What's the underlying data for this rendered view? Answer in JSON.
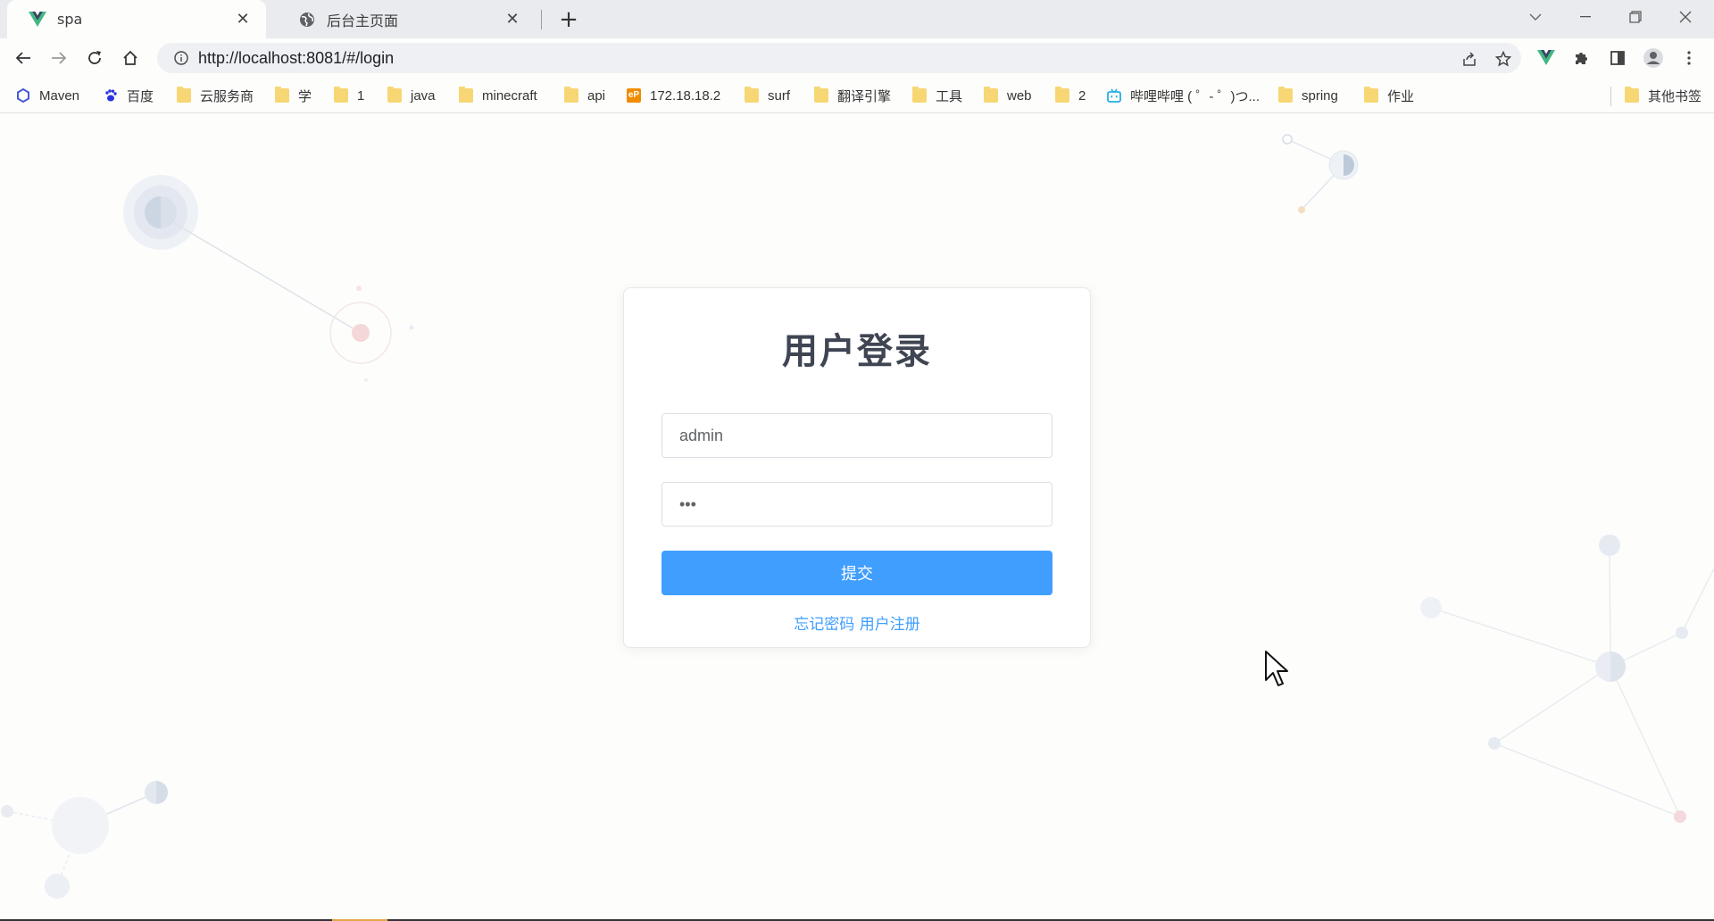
{
  "tabs": [
    {
      "title": "spa",
      "favicon": "vue-logo-icon",
      "active": true
    },
    {
      "title": "后台主页面",
      "favicon": "globe-icon",
      "active": false
    }
  ],
  "address_bar": {
    "url": "http://localhost:8081/#/login"
  },
  "bookmarks": [
    {
      "label": "Maven",
      "icon": "maven-icon"
    },
    {
      "label": "百度",
      "icon": "baidu-paw-icon"
    },
    {
      "label": "云服务商",
      "icon": "folder-icon"
    },
    {
      "label": "学",
      "icon": "folder-icon"
    },
    {
      "label": "1",
      "icon": "folder-icon"
    },
    {
      "label": "java",
      "icon": "folder-icon"
    },
    {
      "label": "minecraft",
      "icon": "folder-icon"
    },
    {
      "label": "api",
      "icon": "folder-icon"
    },
    {
      "label": "172.18.18.2",
      "icon": "ep-icon",
      "badge": "eP"
    },
    {
      "label": "surf",
      "icon": "folder-icon"
    },
    {
      "label": "翻译引擎",
      "icon": "folder-icon"
    },
    {
      "label": "工具",
      "icon": "folder-icon"
    },
    {
      "label": "web",
      "icon": "folder-icon"
    },
    {
      "label": "2",
      "icon": "folder-icon"
    },
    {
      "label": "哔哩哔哩 ( ゜- ゜)つ...",
      "icon": "bilibili-icon"
    },
    {
      "label": "spring",
      "icon": "folder-icon"
    },
    {
      "label": "作业",
      "icon": "folder-icon"
    }
  ],
  "other_bookmarks": {
    "label": "其他书签",
    "icon": "folder-icon"
  },
  "login": {
    "title": "用户登录",
    "username_value": "admin",
    "password_value": "123",
    "submit_label": "提交",
    "forgot_label": "忘记密码",
    "register_label": "用户注册"
  },
  "colors": {
    "primary": "#409eff",
    "title_text": "#3f4552",
    "page_bg": "#fdfdfc"
  }
}
